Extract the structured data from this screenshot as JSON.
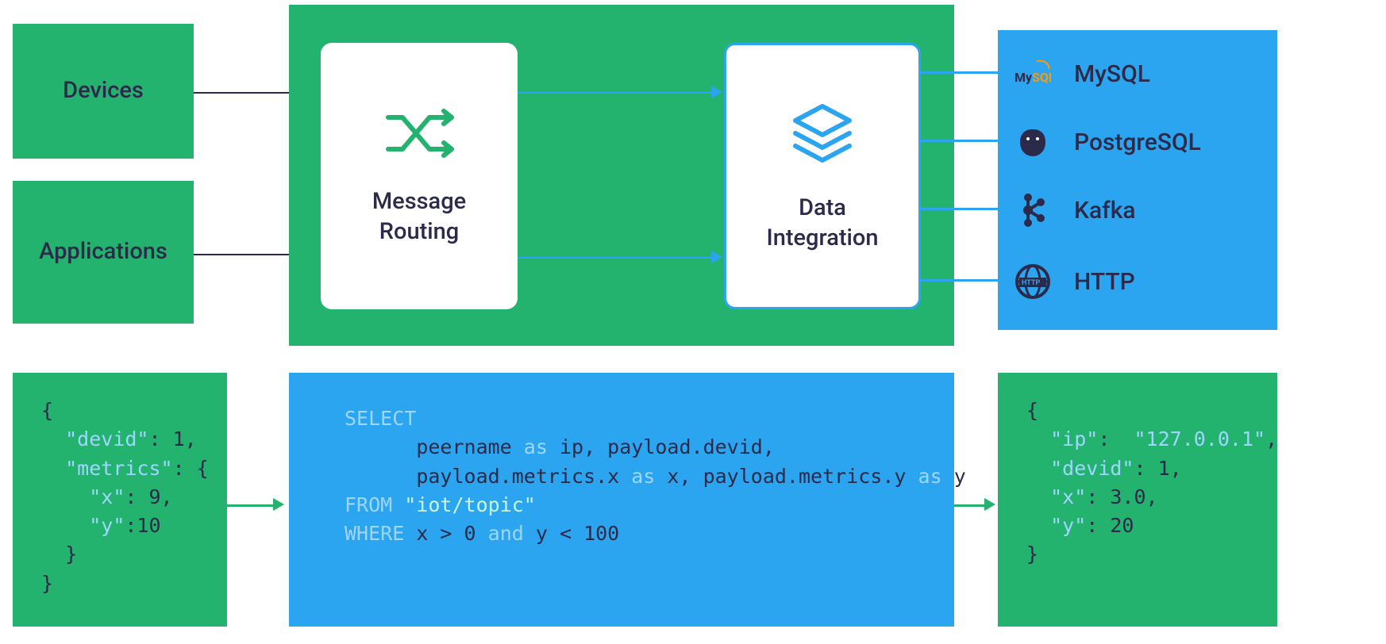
{
  "sources": {
    "devices": "Devices",
    "applications": "Applications"
  },
  "hub": {
    "routing": "Message\nRouting",
    "integration": "Data\nIntegration"
  },
  "destinations": [
    {
      "name": "mysql",
      "label": "MySQL"
    },
    {
      "name": "postgresql",
      "label": "PostgreSQL"
    },
    {
      "name": "kafka",
      "label": "Kafka"
    },
    {
      "name": "http",
      "label": "HTTP"
    }
  ],
  "code": {
    "input": "{\n  \"devid\": 1,\n  \"metrics\": {\n    \"x\": 9,\n    \"y\":10\n  }\n}",
    "sql": {
      "select": "SELECT",
      "fields1_a": "peername",
      "fields1_b": "ip, payload.devid,",
      "fields2_a": "payload.metrics.x",
      "fields2_b": "x, payload.metrics.y",
      "fields2_c": "y",
      "from": "FROM",
      "topic": "\"iot/topic\"",
      "where": "WHERE",
      "cond_a": "x > 0",
      "cond_b": "y < 100"
    },
    "output": "{\n  \"ip\":  \"127.0.0.1\",\n  \"devid\": 1,\n  \"x\": 3.0,\n  \"y\": 20\n}"
  }
}
